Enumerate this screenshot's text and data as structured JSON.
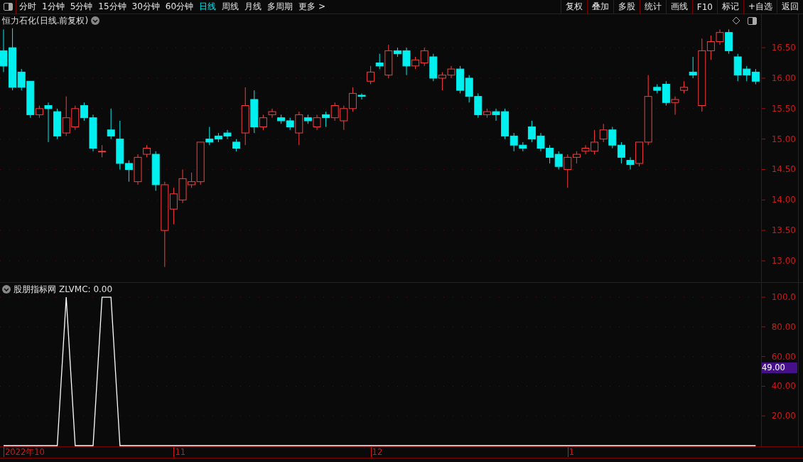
{
  "toolbar": {
    "periods": [
      {
        "label": "分时",
        "selected": false
      },
      {
        "label": "1分钟",
        "selected": false
      },
      {
        "label": "5分钟",
        "selected": false
      },
      {
        "label": "15分钟",
        "selected": false
      },
      {
        "label": "30分钟",
        "selected": false
      },
      {
        "label": "60分钟",
        "selected": false
      },
      {
        "label": "日线",
        "selected": true
      },
      {
        "label": "周线",
        "selected": false
      },
      {
        "label": "月线",
        "selected": false
      },
      {
        "label": "多周期",
        "selected": false
      },
      {
        "label": "更多 >",
        "selected": false
      }
    ],
    "buttons": [
      "复权",
      "叠加",
      "多股",
      "统计",
      "画线",
      "F10",
      "标记",
      "+自选",
      "返回"
    ]
  },
  "main_chart": {
    "title": "恒力石化(日线.前复权)",
    "chart_data": {
      "type": "candlestick",
      "grid": true,
      "ylim": [
        12.65,
        17.05
      ],
      "yticks": [
        {
          "value": 13,
          "label": "13.00"
        },
        {
          "value": 13.5,
          "label": "13.50"
        },
        {
          "value": 14,
          "label": "14.00"
        },
        {
          "value": 14.5,
          "label": "14.50"
        },
        {
          "value": 15,
          "label": "15.00"
        },
        {
          "value": 15.5,
          "label": "15.50"
        },
        {
          "value": 16,
          "label": "16.00"
        },
        {
          "value": 16.5,
          "label": "16.50"
        }
      ],
      "ohlc": [
        [
          16.45,
          16.8,
          16.1,
          16.2
        ],
        [
          16.5,
          16.82,
          15.8,
          15.85
        ],
        [
          16.1,
          16.15,
          15.8,
          15.85
        ],
        [
          15.95,
          15.95,
          15.35,
          15.4
        ],
        [
          15.4,
          15.55,
          15.35,
          15.5
        ],
        [
          15.55,
          15.6,
          14.95,
          15.5
        ],
        [
          15.45,
          15.5,
          15.0,
          15.05
        ],
        [
          15.1,
          15.7,
          15.05,
          15.35
        ],
        [
          15.2,
          15.55,
          15.15,
          15.5
        ],
        [
          15.55,
          15.6,
          15.3,
          15.35
        ],
        [
          15.35,
          15.4,
          14.8,
          14.85
        ],
        [
          14.8,
          14.9,
          14.7,
          14.8
        ],
        [
          15.15,
          15.5,
          15.0,
          15.05
        ],
        [
          15.0,
          15.3,
          14.5,
          14.6
        ],
        [
          14.6,
          14.65,
          14.3,
          14.5
        ],
        [
          14.3,
          14.75,
          14.25,
          14.7
        ],
        [
          14.75,
          14.9,
          14.7,
          14.85
        ],
        [
          14.75,
          14.8,
          14.15,
          14.25
        ],
        [
          13.5,
          14.3,
          12.9,
          14.25
        ],
        [
          13.85,
          14.2,
          13.6,
          14.1
        ],
        [
          14.0,
          14.5,
          13.95,
          14.35
        ],
        [
          14.25,
          14.45,
          14.2,
          14.3
        ],
        [
          14.3,
          14.95,
          14.25,
          14.95
        ],
        [
          15.0,
          15.2,
          14.9,
          14.95
        ],
        [
          15.05,
          15.1,
          14.95,
          15.0
        ],
        [
          15.1,
          15.15,
          15.0,
          15.05
        ],
        [
          14.95,
          15.0,
          14.8,
          14.85
        ],
        [
          15.1,
          15.85,
          14.9,
          15.55
        ],
        [
          15.65,
          15.8,
          15.1,
          15.2
        ],
        [
          15.2,
          15.4,
          15.15,
          15.35
        ],
        [
          15.4,
          15.5,
          15.35,
          15.45
        ],
        [
          15.35,
          15.4,
          15.25,
          15.3
        ],
        [
          15.3,
          15.35,
          15.15,
          15.2
        ],
        [
          15.1,
          15.45,
          14.9,
          15.4
        ],
        [
          15.35,
          15.4,
          15.25,
          15.3
        ],
        [
          15.2,
          15.4,
          15.15,
          15.35
        ],
        [
          15.4,
          15.45,
          15.2,
          15.35
        ],
        [
          15.35,
          15.6,
          15.3,
          15.55
        ],
        [
          15.3,
          15.55,
          15.15,
          15.5
        ],
        [
          15.5,
          15.85,
          15.45,
          15.75
        ],
        [
          15.72,
          15.75,
          15.65,
          15.7
        ],
        [
          15.95,
          16.2,
          15.9,
          16.1
        ],
        [
          16.25,
          16.4,
          16.15,
          16.2
        ],
        [
          16.05,
          16.55,
          16.0,
          16.45
        ],
        [
          16.45,
          16.5,
          16.35,
          16.4
        ],
        [
          16.45,
          16.5,
          16.05,
          16.2
        ],
        [
          16.2,
          16.35,
          16.15,
          16.3
        ],
        [
          16.25,
          16.5,
          16.2,
          16.45
        ],
        [
          16.35,
          16.4,
          15.95,
          16.0
        ],
        [
          16.0,
          16.1,
          15.8,
          16.05
        ],
        [
          16.05,
          16.2,
          16.0,
          16.15
        ],
        [
          16.15,
          16.2,
          15.75,
          15.8
        ],
        [
          16.0,
          16.05,
          15.6,
          15.7
        ],
        [
          15.7,
          15.75,
          15.35,
          15.4
        ],
        [
          15.4,
          15.5,
          15.35,
          15.45
        ],
        [
          15.45,
          15.5,
          15.3,
          15.4
        ],
        [
          15.45,
          15.5,
          15.0,
          15.05
        ],
        [
          15.05,
          15.1,
          14.8,
          14.9
        ],
        [
          14.9,
          14.95,
          14.8,
          14.85
        ],
        [
          15.2,
          15.3,
          14.95,
          15.0
        ],
        [
          15.05,
          15.1,
          14.8,
          14.85
        ],
        [
          14.85,
          14.9,
          14.6,
          14.7
        ],
        [
          14.75,
          14.8,
          14.5,
          14.55
        ],
        [
          14.5,
          14.75,
          14.2,
          14.7
        ],
        [
          14.7,
          14.8,
          14.6,
          14.75
        ],
        [
          14.8,
          14.9,
          14.75,
          14.85
        ],
        [
          14.8,
          15.15,
          14.75,
          14.95
        ],
        [
          15.0,
          15.25,
          14.95,
          15.15
        ],
        [
          15.15,
          15.2,
          14.85,
          14.9
        ],
        [
          14.9,
          14.95,
          14.6,
          14.7
        ],
        [
          14.65,
          14.7,
          14.5,
          14.58
        ],
        [
          14.6,
          14.95,
          14.55,
          14.95
        ],
        [
          14.95,
          16.05,
          14.9,
          15.7
        ],
        [
          15.85,
          15.9,
          15.75,
          15.8
        ],
        [
          15.9,
          15.95,
          15.55,
          15.6
        ],
        [
          15.6,
          15.7,
          15.4,
          15.65
        ],
        [
          15.8,
          15.95,
          15.75,
          15.85
        ],
        [
          16.1,
          16.35,
          16.0,
          16.05
        ],
        [
          15.55,
          16.65,
          15.45,
          16.45
        ],
        [
          16.45,
          16.7,
          16.3,
          16.6
        ],
        [
          16.6,
          16.8,
          16.55,
          16.75
        ],
        [
          16.75,
          16.8,
          16.4,
          16.45
        ],
        [
          16.35,
          16.4,
          15.95,
          16.05
        ],
        [
          16.15,
          16.2,
          15.95,
          16.05
        ],
        [
          16.1,
          16.15,
          15.9,
          15.95
        ]
      ]
    }
  },
  "indicator": {
    "name": "股朋指标网",
    "reading": "ZLVMC: 0.00",
    "current_value": "49.00",
    "chart_data": {
      "type": "line",
      "grid": true,
      "ylim": [
        0,
        101
      ],
      "yticks": [
        {
          "value": 20,
          "label": "20.00"
        },
        {
          "value": 40,
          "label": "40.00"
        },
        {
          "value": 60,
          "label": "60.00"
        },
        {
          "value": 80,
          "label": "80.00"
        },
        {
          "value": 100,
          "label": "100.0"
        }
      ],
      "series": [
        {
          "color": "#ffffff",
          "values": [
            0,
            0,
            0,
            0,
            0,
            0,
            0,
            100,
            0,
            0,
            0,
            100,
            100,
            0,
            0,
            0,
            0,
            0,
            0,
            0,
            0,
            0,
            0,
            0,
            0,
            0,
            0,
            0,
            0,
            0,
            0,
            0,
            0,
            0,
            0,
            0,
            0,
            0,
            0,
            0,
            0,
            0,
            0,
            0,
            0,
            0,
            0,
            0,
            0,
            0,
            0,
            0,
            0,
            0,
            0,
            0,
            0,
            0,
            0,
            0,
            0,
            0,
            0,
            0,
            0,
            0,
            0,
            0,
            0,
            0,
            0,
            0,
            0,
            0,
            0,
            0,
            0,
            0,
            0,
            0,
            0,
            0,
            0,
            0,
            0
          ]
        }
      ]
    }
  },
  "x_axis": {
    "labels": [
      "2022年10",
      "11",
      "12",
      "1"
    ]
  }
}
